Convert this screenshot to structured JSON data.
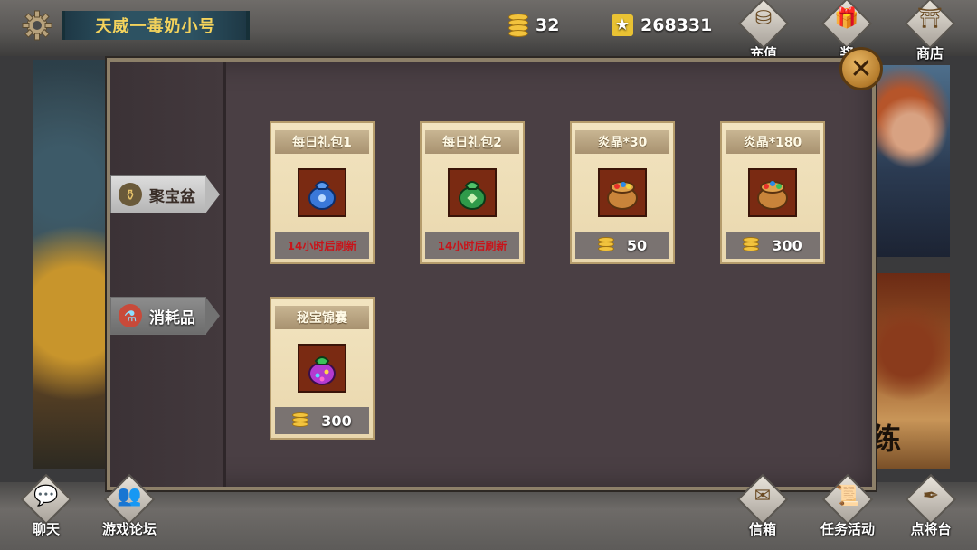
{
  "player": {
    "name": "天威一毒奶小号"
  },
  "currency": {
    "coins": "32",
    "points": "268331"
  },
  "top_nav": [
    {
      "label": "充值",
      "icon": "lucky-bag-icon"
    },
    {
      "label": "奖",
      "icon": "gift-icon"
    },
    {
      "label": "商店",
      "icon": "pagoda-icon"
    }
  ],
  "sidebar": {
    "items": [
      {
        "label": "聚宝盆",
        "icon": "treasure-bowl-icon",
        "active": false
      },
      {
        "label": "消耗品",
        "icon": "potion-icon",
        "active": true
      }
    ]
  },
  "items": [
    {
      "title": "每日礼包1",
      "icon": "blue-bag-icon",
      "footer_text": "14小时后刷新",
      "price": ""
    },
    {
      "title": "每日礼包2",
      "icon": "green-bag-icon",
      "footer_text": "14小时后刷新",
      "price": ""
    },
    {
      "title": "炎晶*30",
      "icon": "gem-sack-icon",
      "footer_text": "",
      "price": "50"
    },
    {
      "title": "炎晶*180",
      "icon": "gem-sack-icon",
      "footer_text": "",
      "price": "300"
    },
    {
      "title": "秘宝锦囊",
      "icon": "purple-bag-icon",
      "footer_text": "",
      "price": "300"
    }
  ],
  "bottom_nav": [
    {
      "label": "聊天",
      "icon": "chat-icon"
    },
    {
      "label": "游戏论坛",
      "icon": "forum-icon"
    },
    {
      "label": "信箱",
      "icon": "mail-icon"
    },
    {
      "label": "任务活动",
      "icon": "scroll-icon"
    },
    {
      "label": "点将台",
      "icon": "quill-icon"
    }
  ],
  "background_text": {
    "right_banner_char": "练"
  }
}
